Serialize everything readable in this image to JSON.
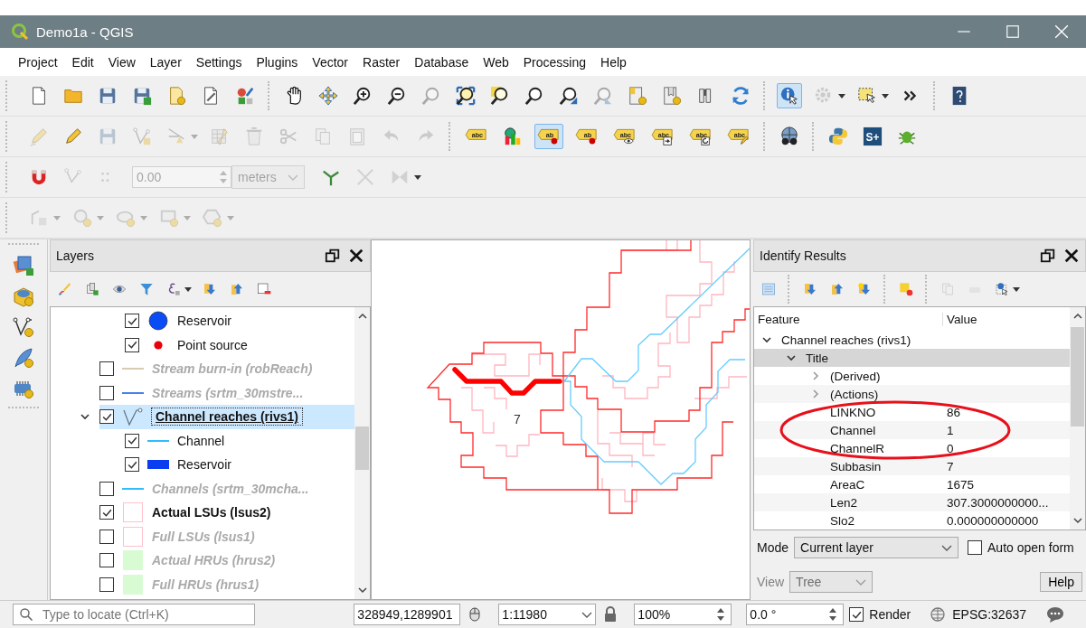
{
  "window": {
    "title": "Demo1a - QGIS"
  },
  "menu": [
    "Project",
    "Edit",
    "View",
    "Layer",
    "Settings",
    "Plugins",
    "Vector",
    "Raster",
    "Database",
    "Web",
    "Processing",
    "Help"
  ],
  "toolbars": [
    [
      {
        "kind": "doc",
        "disabled": false,
        "active": false
      },
      {
        "kind": "folder",
        "disabled": false,
        "active": false
      },
      {
        "kind": "save",
        "disabled": false,
        "active": false
      },
      {
        "kind": "save-as",
        "disabled": false,
        "active": false
      },
      {
        "kind": "doc-star",
        "disabled": false,
        "active": false
      },
      {
        "kind": "doc-tool",
        "disabled": false,
        "active": false
      },
      {
        "kind": "style",
        "disabled": false,
        "active": false
      },
      {
        "kind": "sep"
      },
      {
        "kind": "hand",
        "disabled": false,
        "active": false
      },
      {
        "kind": "pan",
        "disabled": false,
        "active": false
      },
      {
        "kind": "zoom-in",
        "disabled": false,
        "active": false
      },
      {
        "kind": "zoom-out",
        "disabled": false,
        "active": false
      },
      {
        "kind": "zoom-native",
        "disabled": true,
        "active": false
      },
      {
        "kind": "zoom-full",
        "disabled": false,
        "active": false
      },
      {
        "kind": "zoom-layer",
        "disabled": false,
        "active": false
      },
      {
        "kind": "magnifier",
        "disabled": false,
        "active": false
      },
      {
        "kind": "zoom-back",
        "disabled": false,
        "active": false
      },
      {
        "kind": "zoom-next",
        "disabled": true,
        "active": false
      },
      {
        "kind": "bookmark",
        "disabled": false,
        "active": false
      },
      {
        "kind": "bookmark2",
        "disabled": false,
        "active": false
      },
      {
        "kind": "bookmark3",
        "disabled": false,
        "active": false
      },
      {
        "kind": "refresh",
        "disabled": false,
        "active": false
      },
      {
        "kind": "sep"
      },
      {
        "kind": "info",
        "disabled": false,
        "active": true
      },
      {
        "kind": "gear",
        "disabled": true,
        "active": false
      },
      {
        "kind": "caret",
        "disabled": false
      },
      {
        "kind": "select",
        "disabled": false,
        "active": false
      },
      {
        "kind": "caret",
        "disabled": false
      },
      {
        "kind": "more",
        "disabled": false
      },
      {
        "kind": "sep"
      },
      {
        "kind": "help",
        "disabled": false
      }
    ],
    [
      {
        "kind": "pencil-multi",
        "disabled": true,
        "active": false
      },
      {
        "kind": "pencil",
        "disabled": false,
        "active": false
      },
      {
        "kind": "save-edit",
        "disabled": true,
        "active": false
      },
      {
        "kind": "node-add",
        "disabled": true,
        "active": false
      },
      {
        "kind": "node-cut",
        "disabled": true,
        "active": false
      },
      {
        "kind": "caret",
        "disabled": true
      },
      {
        "kind": "table-edit",
        "disabled": true,
        "active": false
      },
      {
        "kind": "trash",
        "disabled": true,
        "active": false
      },
      {
        "kind": "scissors",
        "disabled": true,
        "active": false
      },
      {
        "kind": "copy",
        "disabled": true,
        "active": false
      },
      {
        "kind": "paste",
        "disabled": true,
        "active": false
      },
      {
        "kind": "undo",
        "disabled": true,
        "active": false
      },
      {
        "kind": "redo",
        "disabled": true,
        "active": false
      },
      {
        "kind": "sep"
      },
      {
        "kind": "label",
        "text": "abc",
        "disabled": false,
        "active": false
      },
      {
        "kind": "chart",
        "disabled": false,
        "active": false
      },
      {
        "kind": "label-pin",
        "text": "ab",
        "disabled": false,
        "active": true
      },
      {
        "kind": "label-pin",
        "text": "ab",
        "disabled": false,
        "active": false
      },
      {
        "kind": "label-eye",
        "text": "abc",
        "disabled": false,
        "active": false
      },
      {
        "kind": "label-move",
        "text": "abc",
        "disabled": false,
        "active": false
      },
      {
        "kind": "label-rotate",
        "text": "abc",
        "disabled": false,
        "active": false
      },
      {
        "kind": "label-edit",
        "text": "abc",
        "disabled": false,
        "active": false
      },
      {
        "kind": "sep"
      },
      {
        "kind": "globe",
        "disabled": false,
        "active": false
      },
      {
        "kind": "sep"
      },
      {
        "kind": "python",
        "disabled": false,
        "active": false
      },
      {
        "kind": "splus",
        "text": "S+",
        "disabled": false,
        "active": false
      },
      {
        "kind": "bug",
        "disabled": false,
        "active": false
      }
    ],
    [
      {
        "kind": "magnet",
        "disabled": false
      },
      {
        "kind": "node-snap",
        "disabled": true
      },
      {
        "kind": "dots",
        "disabled": true
      },
      {
        "kind": "number-field",
        "value": "0.00",
        "disabled": true
      },
      {
        "kind": "combo",
        "value": "meters",
        "disabled": true
      },
      {
        "kind": "y-tool",
        "disabled": false
      },
      {
        "kind": "x-tool",
        "disabled": true
      },
      {
        "kind": "bowtie",
        "disabled": true
      },
      {
        "kind": "caret",
        "disabled": false
      }
    ],
    [
      {
        "kind": "digitize-line",
        "disabled": true
      },
      {
        "kind": "caret",
        "disabled": true
      },
      {
        "kind": "circle-star",
        "disabled": true
      },
      {
        "kind": "caret",
        "disabled": true
      },
      {
        "kind": "cloud-star",
        "disabled": true
      },
      {
        "kind": "caret",
        "disabled": true
      },
      {
        "kind": "rect-star",
        "disabled": true
      },
      {
        "kind": "caret",
        "disabled": true
      },
      {
        "kind": "hex-star",
        "disabled": true
      },
      {
        "kind": "caret",
        "disabled": true
      }
    ]
  ],
  "left_toolbar": [
    {
      "kind": "add-layer",
      "disabled": false
    },
    {
      "kind": "database",
      "disabled": false
    },
    {
      "kind": "vector-node",
      "disabled": false
    },
    {
      "kind": "feather",
      "disabled": false
    },
    {
      "kind": "raster-chip",
      "disabled": false
    }
  ],
  "layers": {
    "title": "Layers",
    "toolbar": [
      {
        "kind": "brush",
        "disabled": false
      },
      {
        "kind": "add-group",
        "disabled": false
      },
      {
        "kind": "eye",
        "disabled": false
      },
      {
        "kind": "filter",
        "disabled": false
      },
      {
        "kind": "epsilon",
        "disabled": false
      },
      {
        "kind": "caret",
        "disabled": false
      },
      {
        "kind": "expand-all",
        "disabled": false
      },
      {
        "kind": "collapse-all",
        "disabled": false
      },
      {
        "kind": "remove-layer",
        "disabled": false
      }
    ],
    "items": [
      {
        "kind": "legend",
        "label": "Reservoir",
        "checked": true,
        "symbol": {
          "kind": "circle",
          "color": "#0a4df5"
        }
      },
      {
        "kind": "legend",
        "label": "Point source",
        "checked": true,
        "symbol": {
          "kind": "dot",
          "color": "#e8000b"
        }
      },
      {
        "kind": "layer",
        "label": "Stream burn-in (robReach)",
        "checked": false,
        "selected": false,
        "symbol": {
          "kind": "line",
          "color": "#d8cbb3"
        }
      },
      {
        "kind": "layer",
        "label": "Streams (srtm_30mstre...",
        "checked": false,
        "selected": false,
        "symbol": {
          "kind": "line",
          "color": "#4a7ff0"
        }
      },
      {
        "kind": "layer",
        "label": "Channel reaches (rivs1)",
        "checked": true,
        "selected": true,
        "expanded": true,
        "symbol": {
          "kind": "geometry"
        },
        "children": [
          {
            "kind": "legend",
            "label": "Channel",
            "checked": true,
            "symbol": {
              "kind": "line",
              "color": "#33bbff"
            }
          },
          {
            "kind": "legend",
            "label": "Reservoir",
            "checked": true,
            "symbol": {
              "kind": "bar",
              "color": "#0a3cf0"
            }
          }
        ]
      },
      {
        "kind": "layer",
        "label": "Channels (srtm_30mcha...",
        "checked": false,
        "selected": false,
        "symbol": {
          "kind": "line",
          "color": "#33bbff"
        }
      },
      {
        "kind": "layer",
        "label": "Actual LSUs (lsus2)",
        "checked": true,
        "selected": false,
        "symbol": {
          "kind": "square",
          "color": "#ffc0cb"
        }
      },
      {
        "kind": "layer",
        "label": "Full LSUs (lsus1)",
        "checked": false,
        "selected": false,
        "symbol": {
          "kind": "square",
          "color": "#ffc0cb"
        }
      },
      {
        "kind": "layer",
        "label": "Actual HRUs (hrus2)",
        "checked": false,
        "selected": false,
        "symbol": {
          "kind": "fill",
          "color": "#d8fbd4"
        }
      },
      {
        "kind": "layer",
        "label": "Full HRUs (hrus1)",
        "checked": false,
        "selected": false,
        "symbol": {
          "kind": "fill",
          "color": "#d8fbd4"
        }
      }
    ]
  },
  "map": {
    "feature_label": "7"
  },
  "identify": {
    "title": "Identify Results",
    "toolbar": [
      {
        "kind": "tree-view",
        "disabled": false
      },
      {
        "kind": "sep"
      },
      {
        "kind": "expand-all",
        "disabled": false
      },
      {
        "kind": "collapse-all",
        "disabled": false
      },
      {
        "kind": "expand-star",
        "disabled": false
      },
      {
        "kind": "sep"
      },
      {
        "kind": "clear-highlight",
        "disabled": false
      },
      {
        "kind": "sep"
      },
      {
        "kind": "copy",
        "disabled": true
      },
      {
        "kind": "print",
        "disabled": true
      },
      {
        "kind": "identify-settings",
        "disabled": false
      },
      {
        "kind": "caret",
        "disabled": false
      }
    ],
    "columns": [
      "Feature",
      "Value"
    ],
    "rows": [
      {
        "feature": "Channel reaches (rivs1)",
        "selected": false,
        "expanded": true,
        "children": [
          {
            "feature": "Title",
            "selected": true,
            "expanded": true,
            "children": [
              {
                "feature": "(Derived)",
                "selected": false,
                "expanded": false
              },
              {
                "feature": "(Actions)",
                "selected": false,
                "expanded": false
              },
              {
                "feature": "LINKNO",
                "value": "86",
                "selected": false
              },
              {
                "feature": "Channel",
                "value": "1",
                "selected": false
              },
              {
                "feature": "ChannelR",
                "value": "0",
                "selected": false
              },
              {
                "feature": "Subbasin",
                "value": "7",
                "selected": false
              },
              {
                "feature": "AreaC",
                "value": "1675",
                "selected": false
              },
              {
                "feature": "Len2",
                "value": "307.3000000000...",
                "selected": false
              },
              {
                "feature": "Slo2",
                "value": "0.000000000000",
                "selected": false
              }
            ]
          }
        ]
      }
    ],
    "mode_label": "Mode",
    "mode": "Current layer",
    "auto_open_form": {
      "label": "Auto open form",
      "checked": false
    },
    "view_label": "View",
    "view": {
      "value": "Tree",
      "disabled": true
    },
    "help": "Help"
  },
  "status_bar": {
    "locate_placeholder": "Type to locate (Ctrl+K)",
    "coordinate": "328949,1289901",
    "scale": "1:11980",
    "magnifier": "100%",
    "rotation": "0.0 °",
    "render": {
      "label": "Render",
      "checked": true
    },
    "crs": "EPSG:32637"
  }
}
